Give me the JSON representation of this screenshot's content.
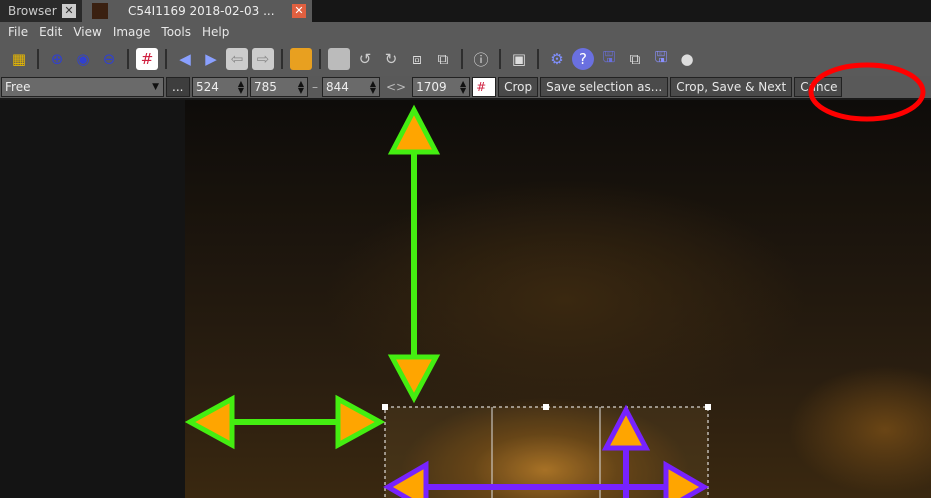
{
  "tabs": [
    {
      "label": "Browser"
    },
    {
      "label": "C54I1169 2018-02-03 ..."
    }
  ],
  "menu": [
    "File",
    "Edit",
    "View",
    "Image",
    "Tools",
    "Help"
  ],
  "crop": {
    "ratio": "Free",
    "more": "...",
    "x": "524",
    "y": "785",
    "w": "844",
    "h": "1709",
    "sep1": "–",
    "sep2": "<>",
    "crop": "Crop",
    "save_as": "Save selection as...",
    "crop_save_next": "Crop, Save & Next",
    "cancel": "Cance"
  },
  "colors": {
    "green": "#44ee11",
    "orange": "#ffa500",
    "purple": "#7722ff",
    "red": "#ff0000"
  }
}
